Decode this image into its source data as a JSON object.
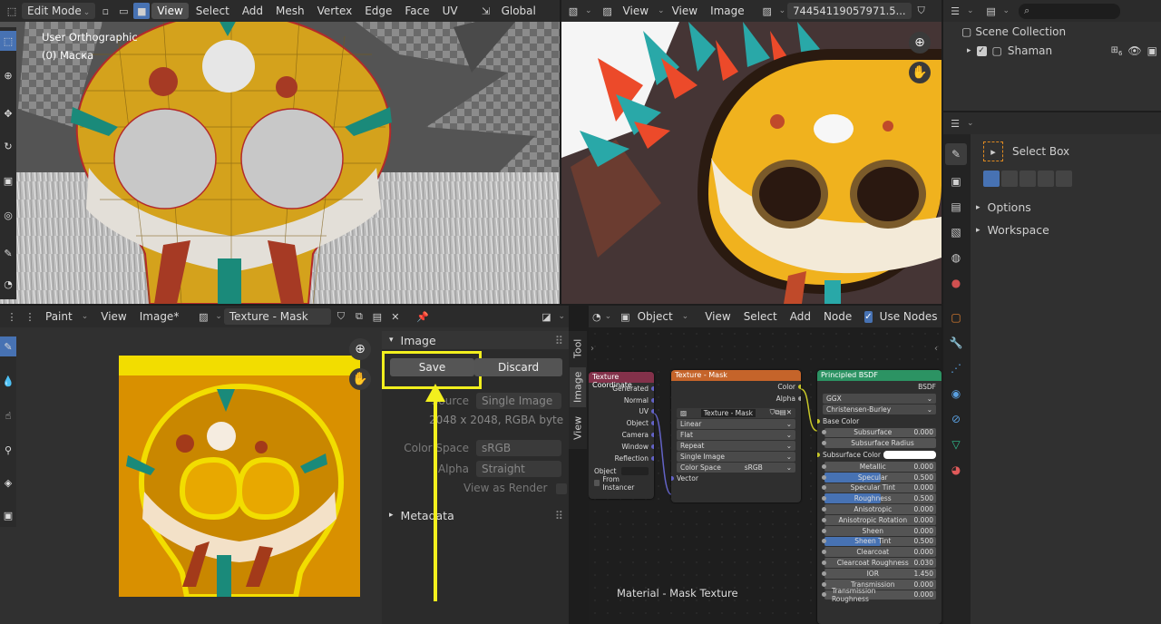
{
  "viewport3d": {
    "mode": "Edit Mode",
    "menus": [
      "View",
      "Select",
      "Add",
      "Mesh",
      "Vertex",
      "Edge",
      "Face",
      "UV"
    ],
    "transform": "Global",
    "overlay_title": "User Orthographic",
    "overlay_object": "(0) Маска"
  },
  "imageviewer": {
    "menus": [
      "View",
      "View",
      "Image"
    ],
    "image_name": "74454119057971.5..."
  },
  "outliner": {
    "collection": "Scene Collection",
    "object": "Shaman",
    "object_badge": "6"
  },
  "tool_props": {
    "tool": "Select Box",
    "options": "Options",
    "workspace": "Workspace"
  },
  "image_editor": {
    "mode": "Paint",
    "menus": [
      "View",
      "Image*"
    ],
    "texture": "Texture - Mask",
    "panel_title": "Image",
    "save": "Save",
    "discard": "Discard",
    "source_label": "Source",
    "source_value": "Single Image",
    "resolution": "2048 x 2048,  RGBA byte",
    "colorspace_label": "Color Space",
    "colorspace_value": "sRGB",
    "alpha_label": "Alpha",
    "alpha_value": "Straight",
    "view_as_render": "View as Render",
    "metadata": "Metadata",
    "tabs": [
      "Tool",
      "Image",
      "View"
    ]
  },
  "node_editor": {
    "mode": "Object",
    "menus": [
      "View",
      "Select",
      "Add",
      "Node"
    ],
    "use_nodes": "Use Nodes",
    "material_label": "Material - Mask Texture",
    "texcoord": {
      "title": "Texture Coordinate",
      "outputs": [
        "Generated",
        "Normal",
        "UV",
        "Object",
        "Camera",
        "Window",
        "Reflection"
      ],
      "object_label": "Object",
      "from_instancer": "From Instancer"
    },
    "teximage": {
      "title": "Texture - Mask",
      "outputs": [
        "Color",
        "Alpha"
      ],
      "image": "Texture - Mask",
      "fields": [
        "Linear",
        "Flat",
        "Repeat",
        "Single Image"
      ],
      "colorspace_label": "Color Space",
      "colorspace": "sRGB",
      "vector": "Vector"
    },
    "bsdf": {
      "title": "Principled BSDF",
      "output": "BSDF",
      "dist": "GGX",
      "sss_method": "Christensen-Burley",
      "base_color": "Base Color",
      "sss_color": "Subsurface Color",
      "props": [
        {
          "name": "Subsurface",
          "value": "0.000",
          "fill": 0
        },
        {
          "name": "Subsurface Radius",
          "value": "",
          "fill": 0
        },
        {
          "name": "Metallic",
          "value": "0.000",
          "fill": 0
        },
        {
          "name": "Specular",
          "value": "0.500",
          "fill": 0.5
        },
        {
          "name": "Specular Tint",
          "value": "0.000",
          "fill": 0
        },
        {
          "name": "Roughness",
          "value": "0.500",
          "fill": 0.5
        },
        {
          "name": "Anisotropic",
          "value": "0.000",
          "fill": 0
        },
        {
          "name": "Anisotropic Rotation",
          "value": "0.000",
          "fill": 0
        },
        {
          "name": "Sheen",
          "value": "0.000",
          "fill": 0
        },
        {
          "name": "Sheen Tint",
          "value": "0.500",
          "fill": 0.5
        },
        {
          "name": "Clearcoat",
          "value": "0.000",
          "fill": 0
        },
        {
          "name": "Clearcoat Roughness",
          "value": "0.030",
          "fill": 0
        },
        {
          "name": "IOR",
          "value": "1.450",
          "fill": 0
        },
        {
          "name": "Transmission",
          "value": "0.000",
          "fill": 0
        },
        {
          "name": "Transmission Roughness",
          "value": "0.000",
          "fill": 0
        }
      ]
    }
  }
}
